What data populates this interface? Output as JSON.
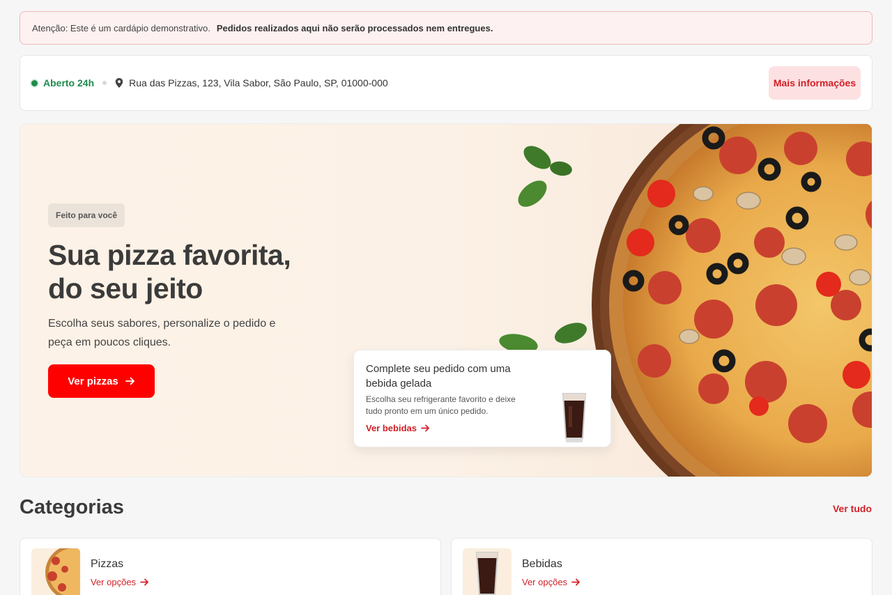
{
  "notice": {
    "text": "Atenção: Este é um cardápio demonstrativo.",
    "strong": "Pedidos realizados aqui não serão processados nem entregues."
  },
  "store": {
    "status": "Aberto 24h",
    "address": "Rua das Pizzas, 123, Vila Sabor, São Paulo, SP, 01000-000",
    "more_info_label": "Mais informações"
  },
  "hero": {
    "tag": "Feito para você",
    "title": "Sua pizza favorita, do seu jeito",
    "subtitle": "Escolha seus sabores, personalize o pedido e peça em poucos cliques.",
    "cta_label": "Ver pizzas"
  },
  "drink_promo": {
    "title": "Complete seu pedido com uma bebida gelada",
    "description": "Escolha seu refrigerante favorito e deixe tudo pronto em um único pedido.",
    "link_label": "Ver bebidas"
  },
  "categories": {
    "heading": "Categorias",
    "see_all_label": "Ver tudo",
    "items": [
      {
        "name": "Pizzas",
        "link_label": "Ver opções",
        "icon": "pizza-icon"
      },
      {
        "name": "Bebidas",
        "link_label": "Ver opções",
        "icon": "soda-glass-icon"
      }
    ]
  },
  "colors": {
    "accent": "#ff0000",
    "accent_text": "#d21f26",
    "open_status": "#1f8a4c",
    "hero_bg": "#fdf2e7"
  }
}
